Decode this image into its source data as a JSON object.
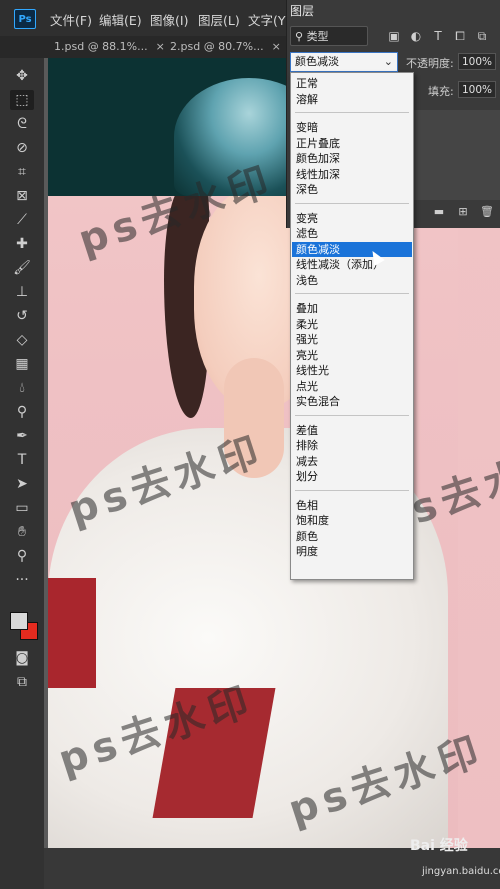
{
  "menubar": {
    "logo": "Ps",
    "items": [
      "文件(F)",
      "编辑(E)",
      "图像(I)",
      "图层(L)",
      "文字(Y)"
    ]
  },
  "tabs": [
    {
      "label": "1.psd @ 88.1%...",
      "close": "×"
    },
    {
      "label": "2.psd @ 80.7%...",
      "close": "×"
    }
  ],
  "tools": [
    "move-icon",
    "marquee-icon",
    "lasso-icon",
    "quick-select-icon",
    "crop-icon",
    "frame-icon",
    "eyedropper-icon",
    "healing-icon",
    "brush-icon",
    "stamp-icon",
    "history-brush-icon",
    "eraser-icon",
    "gradient-icon",
    "blur-icon",
    "dodge-icon",
    "pen-icon",
    "type-icon",
    "path-select-icon",
    "rectangle-icon",
    "hand-icon",
    "zoom-icon",
    "more-icon"
  ],
  "layers_panel": {
    "tab": "图层",
    "filter_label": "类型",
    "blend_mode": "颜色减淡",
    "opacity_label": "不透明度:",
    "opacity_value": "100%",
    "fill_label": "填充:",
    "fill_value": "100%"
  },
  "blend_menu": {
    "groups": [
      [
        "正常",
        "溶解"
      ],
      [
        "变暗",
        "正片叠底",
        "颜色加深",
        "线性加深",
        "深色"
      ],
      [
        "变亮",
        "滤色",
        "颜色减淡",
        "线性减淡（添加）",
        "浅色"
      ],
      [
        "叠加",
        "柔光",
        "强光",
        "亮光",
        "线性光",
        "点光",
        "实色混合"
      ],
      [
        "差值",
        "排除",
        "减去",
        "划分"
      ],
      [
        "色相",
        "饱和度",
        "颜色",
        "明度"
      ]
    ],
    "selected": "颜色减淡"
  },
  "watermark": "ps去水印",
  "footer": {
    "brand": "Bai 经验",
    "url": "jingyan.baidu.com"
  },
  "colors": {
    "foreground": "#d9d9d9",
    "background": "#e52b1f",
    "accent": "#1a73d9"
  }
}
